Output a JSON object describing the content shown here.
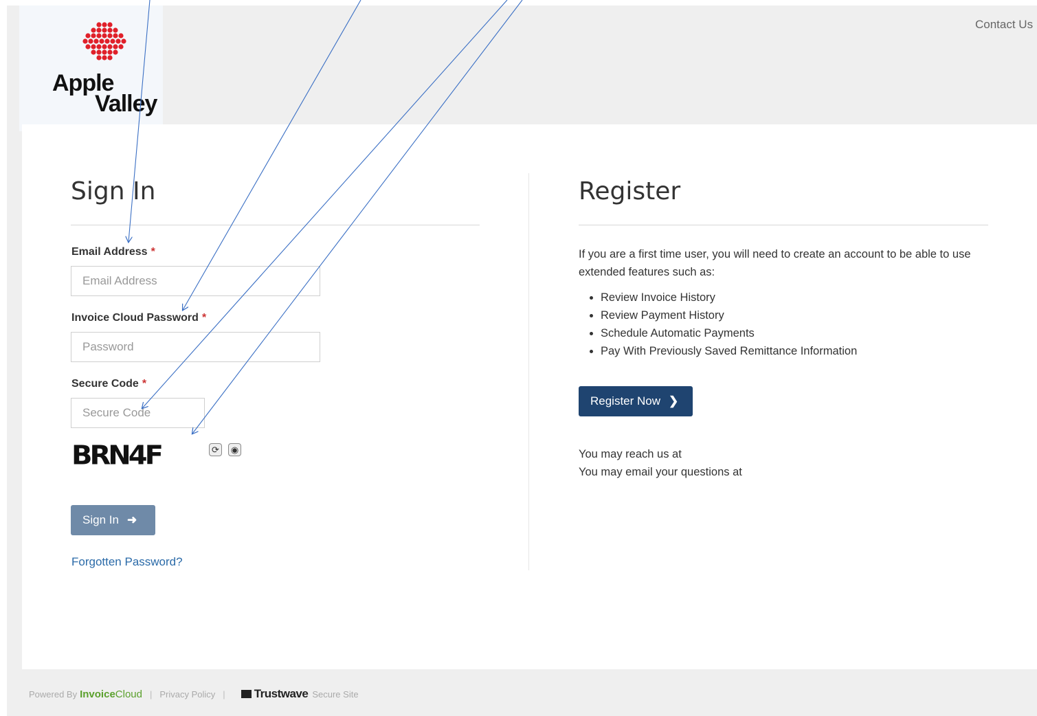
{
  "header": {
    "logo_line1": "Apple",
    "logo_line2": "Valley",
    "contact_link": "Contact Us",
    "logo_dot_color": "#e0202a"
  },
  "signin": {
    "title": "Sign In",
    "email_label": "Email Address",
    "email_placeholder": "Email Address",
    "password_label": "Invoice Cloud Password",
    "password_placeholder": "Password",
    "code_label": "Secure Code",
    "code_placeholder": "Secure Code",
    "required_mark": "*",
    "captcha_text": "BRN4F",
    "captcha_icons": [
      "refresh-icon",
      "audio-icon"
    ],
    "button_label": "Sign In",
    "button_icon": "sign-in-icon",
    "forgot_link": "Forgotten Password?"
  },
  "register": {
    "title": "Register",
    "intro": "If you are a first time user, you will need to create an account to be able to use extended features such as:",
    "features": [
      "Review Invoice History",
      "Review Payment History",
      "Schedule Automatic Payments",
      "Pay With Previously Saved Remittance Information"
    ],
    "button_label": "Register Now",
    "button_icon": "chevron-right-icon",
    "reach_line": "You may reach us at",
    "email_line": "You may email your questions at"
  },
  "footer": {
    "powered_by": "Powered By",
    "brand_bold": "Invoice",
    "brand_light": "Cloud",
    "privacy": "Privacy Policy",
    "trustwave": "Trustwave",
    "secure_site": "Secure Site",
    "separator": "|"
  },
  "colors": {
    "primary_button": "#1f4470",
    "signin_button": "#6f8aa8",
    "link": "#2a6aa8",
    "required": "#cc3333",
    "annotation_arrow": "#3a6fc4"
  }
}
